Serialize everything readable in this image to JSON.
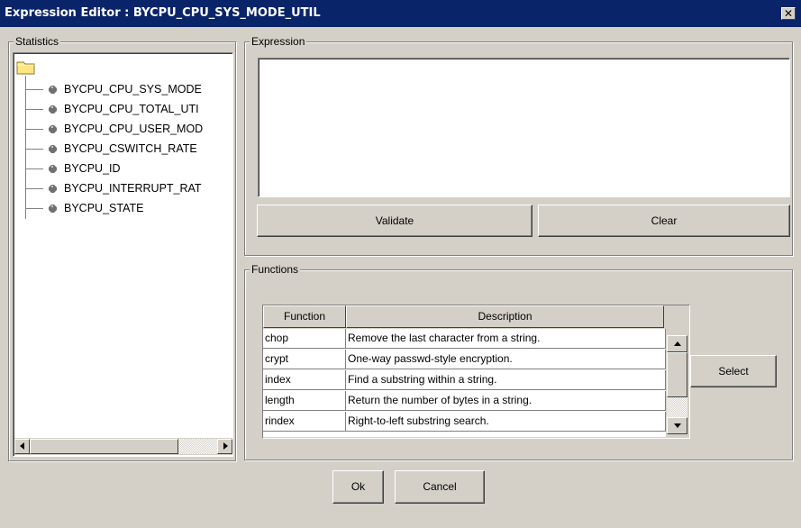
{
  "window": {
    "title": "Expression Editor : BYCPU_CPU_SYS_MODE_UTIL",
    "close_label": "✕"
  },
  "statistics": {
    "legend": "Statistics",
    "items": [
      {
        "label": "BYCPU_CPU_SYS_MODE"
      },
      {
        "label": "BYCPU_CPU_TOTAL_UTI"
      },
      {
        "label": "BYCPU_CPU_USER_MOD"
      },
      {
        "label": "BYCPU_CSWITCH_RATE"
      },
      {
        "label": "BYCPU_ID"
      },
      {
        "label": "BYCPU_INTERRUPT_RAT"
      },
      {
        "label": "BYCPU_STATE"
      }
    ]
  },
  "expression": {
    "legend": "Expression",
    "value": "",
    "validate_label": "Validate",
    "clear_label": "Clear"
  },
  "functions": {
    "legend": "Functions",
    "columns": [
      "Function",
      "Description"
    ],
    "rows": [
      {
        "name": "chop",
        "description": "Remove the last character from a string."
      },
      {
        "name": "crypt",
        "description": "One-way passwd-style encryption."
      },
      {
        "name": "index",
        "description": "Find a substring within a string."
      },
      {
        "name": "length",
        "description": "Return the number of bytes in a string."
      },
      {
        "name": "rindex",
        "description": "Right-to-left substring search."
      }
    ],
    "select_label": "Select"
  },
  "footer": {
    "ok_label": "Ok",
    "cancel_label": "Cancel"
  }
}
